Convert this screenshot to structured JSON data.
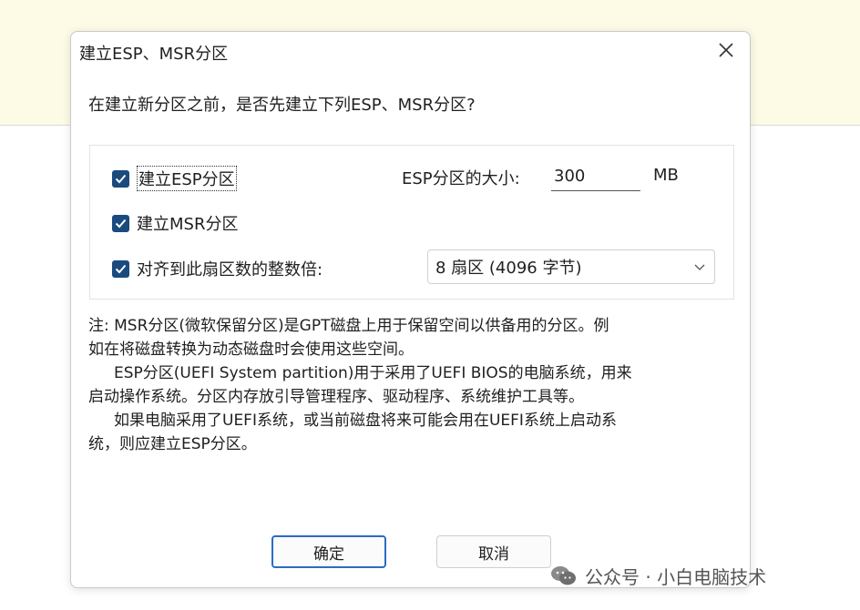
{
  "dialog": {
    "title": "建立ESP、MSR分区",
    "question": "在建立新分区之前，是否先建立下列ESP、MSR分区?",
    "options": {
      "esp_label": "建立ESP分区",
      "msr_label": "建立MSR分区",
      "align_label": "对齐到此扇区数的整数倍:",
      "esp_checked": true,
      "msr_checked": true,
      "align_checked": true
    },
    "esp_size": {
      "label": "ESP分区的大小:",
      "value": "300",
      "unit": "MB"
    },
    "align_select": {
      "value": "8 扇区 (4096 字节)"
    },
    "notes": [
      "注: MSR分区(微软保留分区)是GPT磁盘上用于保留空间以供备用的分区。例",
      "如在将磁盘转换为动态磁盘时会使用这些空间。",
      "ESP分区(UEFI System partition)用于采用了UEFI BIOS的电脑系统，用来",
      "启动操作系统。分区内存放引导管理程序、驱动程序、系统维护工具等。",
      "如果电脑采用了UEFI系统，或当前磁盘将来可能会用在UEFI系统上启动系",
      "统，则应建立ESP分区。"
    ],
    "buttons": {
      "ok": "确定",
      "cancel": "取消"
    }
  },
  "watermark": {
    "text": "公众号 · 小白电脑技术",
    "icon": "wechat-icon"
  },
  "colors": {
    "checkbox": "#1b4a7e",
    "ok_border": "#2b6cc4",
    "background_band": "#fdfbe6"
  }
}
